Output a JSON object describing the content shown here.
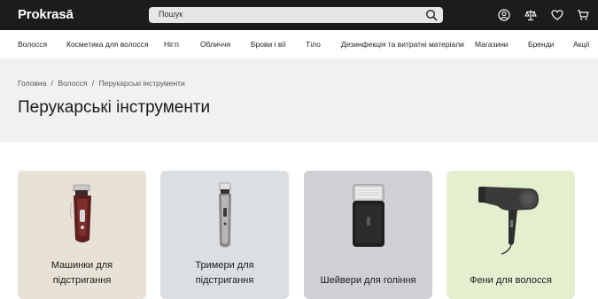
{
  "header": {
    "logo": "Prokrasā",
    "search_placeholder": "Пошук"
  },
  "icons": [
    "account-icon",
    "compare-icon",
    "wishlist-icon",
    "cart-icon",
    "search-icon"
  ],
  "nav": {
    "items": [
      {
        "label": "Волосся"
      },
      {
        "label": "Косметика для волосся"
      },
      {
        "label": "Нігті"
      },
      {
        "label": "Обличчя"
      },
      {
        "label": "Брови і вії"
      },
      {
        "label": "Тіло"
      },
      {
        "label": "Дезинфекція та витратні матеріали"
      },
      {
        "label": "Магазини"
      },
      {
        "label": "Бренди"
      },
      {
        "label": "Акції"
      }
    ]
  },
  "breadcrumb": {
    "items": [
      "Головна",
      "Волосся",
      "Перукарські інструменти"
    ],
    "separator": "/"
  },
  "page_title": "Перукарські інструменти",
  "categories": [
    {
      "line1": "Машинки для",
      "line2": "підстригання",
      "bg": "#e8e1d6"
    },
    {
      "line1": "Тримери для",
      "line2": "підстригання",
      "bg": "#dcdfe2"
    },
    {
      "line1": "Шейвери для гоління",
      "line2": "",
      "bg": "#cfd0d4"
    },
    {
      "line1": "Фени для волосся",
      "line2": "",
      "bg": "#e4efcf"
    }
  ],
  "colors": {
    "header_bg": "#1c1c1c",
    "hero_bg": "#f1f1f4"
  }
}
